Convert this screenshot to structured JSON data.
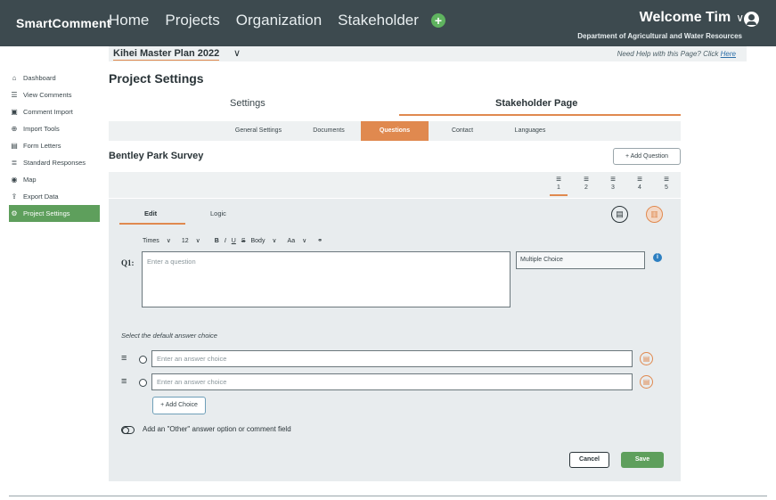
{
  "header": {
    "brand": "SmartComment",
    "nav": [
      "Home",
      "Projects",
      "Organization",
      "Stakeholder"
    ],
    "add_icon": "plus-circle-icon",
    "welcome": "Welcome Tim",
    "welcome_chevron": "∨",
    "user_icon": "user-circle-icon",
    "department": "Department of Agricultural and Water Resources"
  },
  "project": {
    "name": "Kihei Master Plan 2022",
    "chevron": "∨",
    "help_prefix": "Need Help with this Page? Click ",
    "help_link": "Here"
  },
  "sidebar": {
    "items": [
      {
        "label": "Dashboard",
        "icon": "home-icon",
        "glyph": "⌂"
      },
      {
        "label": "View Comments",
        "icon": "comment-icon",
        "glyph": "☰"
      },
      {
        "label": "Comment Import",
        "icon": "file-icon",
        "glyph": "▣"
      },
      {
        "label": "Import Tools",
        "icon": "import-icon",
        "glyph": "⊕"
      },
      {
        "label": "Form Letters",
        "icon": "letter-icon",
        "glyph": "▤"
      },
      {
        "label": "Standard Responses",
        "icon": "responses-icon",
        "glyph": "≣"
      },
      {
        "label": "Map",
        "icon": "map-pin-icon",
        "glyph": "◉"
      },
      {
        "label": "Export Data",
        "icon": "export-icon",
        "glyph": "⇪"
      },
      {
        "label": "Project Settings",
        "icon": "gear-icon",
        "glyph": "⚙"
      }
    ],
    "active_index": 8
  },
  "page": {
    "title": "Project Settings",
    "main_tabs": [
      "Settings",
      "Stakeholder Page"
    ],
    "active_main_tab": "Stakeholder Page",
    "sub_tabs": [
      "General Settings",
      "Documents",
      "Questions",
      "Contact",
      "Languages"
    ],
    "active_sub_tab": "Questions"
  },
  "survey": {
    "title": "Bentley Park Survey",
    "add_question": "+ Add Question",
    "question_numbers": [
      "1",
      "2",
      "3",
      "4",
      "5"
    ],
    "active_question": "1",
    "question_nav_glyph": "≡"
  },
  "editor": {
    "tabs": [
      "Edit",
      "Logic"
    ],
    "active_tab": "Edit",
    "preview_icon": "preview-document-icon",
    "delete_icon": "trash-icon",
    "toolbar": {
      "font": "Times",
      "size": "12",
      "bold": "B",
      "italic": "I",
      "underline": "U",
      "strike": "S",
      "style": "Body",
      "case": "Aa",
      "link_icon": "link-icon",
      "chevron": "∨"
    },
    "question_label": "Q1:",
    "question_placeholder": "Enter a question",
    "question_type": "Multiple Choice",
    "info_icon": "info-icon",
    "default_choice_label": "Select the default answer choice",
    "answers": [
      {
        "placeholder": "Enter an answer choice"
      },
      {
        "placeholder": "Enter an answer choice"
      }
    ],
    "drag_icon": "drag-handle-icon",
    "add_choice": "+ Add Choice",
    "other_option": "Add an \"Other\" answer option or comment field",
    "cancel": "Cancel",
    "save": "Save"
  },
  "colors": {
    "topbar": "#3d4a4f",
    "accent_orange": "#e0894f",
    "accent_green": "#5e9f5c",
    "panel_bg": "#e8ecee",
    "info_blue": "#2d7fc1"
  }
}
